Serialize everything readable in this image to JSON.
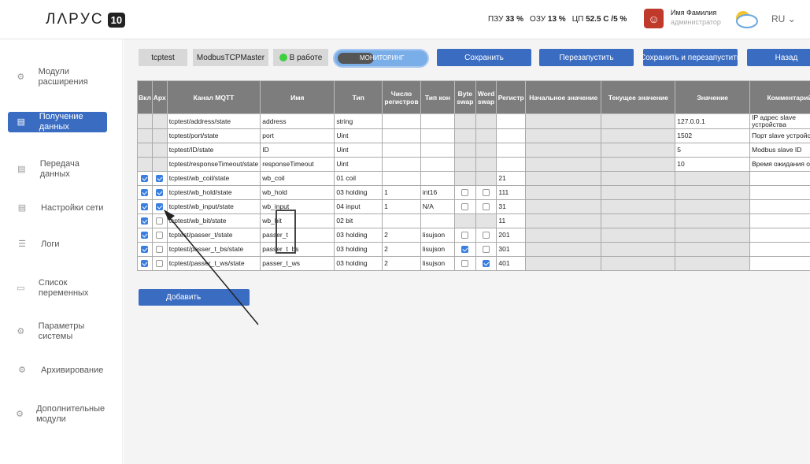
{
  "header": {
    "logo_text": "ЛΛPУС",
    "logo_version": "10",
    "pzu_label": "ПЗУ",
    "pzu_value": "33 %",
    "ozu_label": "ОЗУ",
    "ozu_value": "13 %",
    "cpu_label": "ЦП",
    "cpu_value": "52.5 С /5 %",
    "user_name": "Имя Фамилия",
    "user_role": "администратор",
    "language": "RU"
  },
  "sidebar": {
    "items": [
      {
        "label": "Модули расширения",
        "icon": "modules-icon"
      },
      {
        "label": "Получение данных",
        "icon": "database-icon",
        "active": true
      },
      {
        "label": "Передача данных",
        "icon": "database-icon"
      },
      {
        "label": "Настройки сети",
        "icon": "database-icon"
      },
      {
        "label": "Логи",
        "icon": "list-icon"
      },
      {
        "label": "Список переменных",
        "icon": "variables-icon"
      },
      {
        "label": "Параметры системы",
        "icon": "gear-icon"
      },
      {
        "label": "Архивирование",
        "icon": "gear-icon"
      },
      {
        "label": "Дополнительные модули",
        "icon": "gear-icon"
      }
    ]
  },
  "toolbar": {
    "chip_name": "tcptest",
    "chip_type": "ModbusTCPMaster",
    "status": "В работе",
    "status_color": "#3fcf3f",
    "toggle_label": "МОНИТОРИНГ",
    "save": "Сохранить",
    "restart": "Перезапустить",
    "save_restart": "Сохранить и перезапустить",
    "back": "Назад"
  },
  "table": {
    "headers": [
      "Вкл",
      "Арх",
      "Канал MQTT",
      "Имя",
      "Тип",
      "Число регистров",
      "Тип кон",
      "Byte swap",
      "Word swap",
      "Регистр",
      "Начальное значение",
      "Текущее значение",
      "Значение",
      "Комментарий"
    ],
    "rows": [
      {
        "on": null,
        "arch": null,
        "channel": "tcptest/address/state",
        "name": "address",
        "type": "string",
        "regs": "",
        "conv": "",
        "bswap": null,
        "wswap": null,
        "reg": "",
        "value": "127.0.0.1",
        "comment": "IP адрес slave устройства"
      },
      {
        "on": null,
        "arch": null,
        "channel": "tcptest/port/state",
        "name": "port",
        "type": "Uint",
        "regs": "",
        "conv": "",
        "bswap": null,
        "wswap": null,
        "reg": "",
        "value": "1502",
        "comment": "Порт slave устройства"
      },
      {
        "on": null,
        "arch": null,
        "channel": "tcptest/ID/state",
        "name": "ID",
        "type": "Uint",
        "regs": "",
        "conv": "",
        "bswap": null,
        "wswap": null,
        "reg": "",
        "value": "5",
        "comment": "Modbus slave ID"
      },
      {
        "on": null,
        "arch": null,
        "channel": "tcptest/responseTimeout/state",
        "name": "responseTimeout",
        "type": "Uint",
        "regs": "",
        "conv": "",
        "bswap": null,
        "wswap": null,
        "reg": "",
        "value": "10",
        "comment": "Время ожидания ответа"
      },
      {
        "on": true,
        "arch": true,
        "channel": "tcptest/wb_coil/state",
        "name": "wb_coil",
        "type": "01 coil",
        "regs": "",
        "conv": "",
        "bswap": null,
        "wswap": null,
        "reg": "21",
        "value": "",
        "comment": ""
      },
      {
        "on": true,
        "arch": true,
        "channel": "tcptest/wb_hold/state",
        "name": "wb_hold",
        "type": "03 holding",
        "regs": "1",
        "conv": "int16",
        "bswap": false,
        "wswap": false,
        "reg": "111",
        "value": "",
        "comment": ""
      },
      {
        "on": true,
        "arch": true,
        "channel": "tcptest/wb_input/state",
        "name": "wb_input",
        "type": "04 input",
        "regs": "1",
        "conv": "N/A",
        "bswap": false,
        "wswap": false,
        "reg": "31",
        "value": "",
        "comment": ""
      },
      {
        "on": true,
        "arch": false,
        "channel": "tcptest/wb_bit/state",
        "name": "wb_bit",
        "type": "02 bit",
        "regs": "",
        "conv": "",
        "bswap": null,
        "wswap": null,
        "reg": "11",
        "value": "",
        "comment": ""
      },
      {
        "on": true,
        "arch": false,
        "channel": "tcptest/passer_t/state",
        "name": "passer_t",
        "type": "03 holding",
        "regs": "2",
        "conv": "lisujson",
        "bswap": false,
        "wswap": false,
        "reg": "201",
        "value": "",
        "comment": ""
      },
      {
        "on": true,
        "arch": false,
        "channel": "tcptest/passer_t_bs/state",
        "name": "passer_t_bs",
        "type": "03 holding",
        "regs": "2",
        "conv": "lisujson",
        "bswap": true,
        "wswap": false,
        "reg": "301",
        "value": "",
        "comment": ""
      },
      {
        "on": true,
        "arch": false,
        "channel": "tcptest/passer_t_ws/state",
        "name": "passer_t_ws",
        "type": "03 holding",
        "regs": "2",
        "conv": "lisujson",
        "bswap": false,
        "wswap": true,
        "reg": "401",
        "value": "",
        "comment": ""
      }
    ]
  },
  "add_button": "Добавить"
}
